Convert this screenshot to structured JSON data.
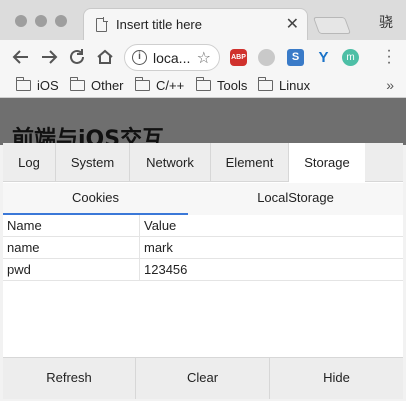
{
  "browser": {
    "tab": {
      "title": "Insert title here",
      "close_symbol": "✕"
    },
    "profile_label": "骁",
    "address_bar": {
      "url_text": "loca..."
    },
    "extensions": {
      "abp": "ABP",
      "ext3": "S",
      "ext4": "Y",
      "ext5": "m"
    },
    "bookmarks": [
      {
        "label": "iOS"
      },
      {
        "label": "Other"
      },
      {
        "label": "C/++"
      },
      {
        "label": "Tools"
      },
      {
        "label": "Linux"
      }
    ],
    "bookmarks_more": "»"
  },
  "page": {
    "title": "前端与iOS交互"
  },
  "console": {
    "tabs": [
      {
        "label": "Log"
      },
      {
        "label": "System"
      },
      {
        "label": "Network"
      },
      {
        "label": "Element"
      },
      {
        "label": "Storage",
        "active": true
      }
    ],
    "sub_tabs": [
      {
        "label": "Cookies",
        "active": true
      },
      {
        "label": "LocalStorage"
      }
    ],
    "table": {
      "header": [
        "Name",
        "Value"
      ],
      "rows": [
        [
          "name",
          "mark"
        ],
        [
          "pwd",
          "123456"
        ]
      ]
    },
    "footer": {
      "refresh_label": "Refresh",
      "clear_label": "Clear",
      "hide_label": "Hide"
    }
  },
  "colors": {
    "accent": "#3b78d8",
    "page_header_bg": "#6f6f6f"
  }
}
